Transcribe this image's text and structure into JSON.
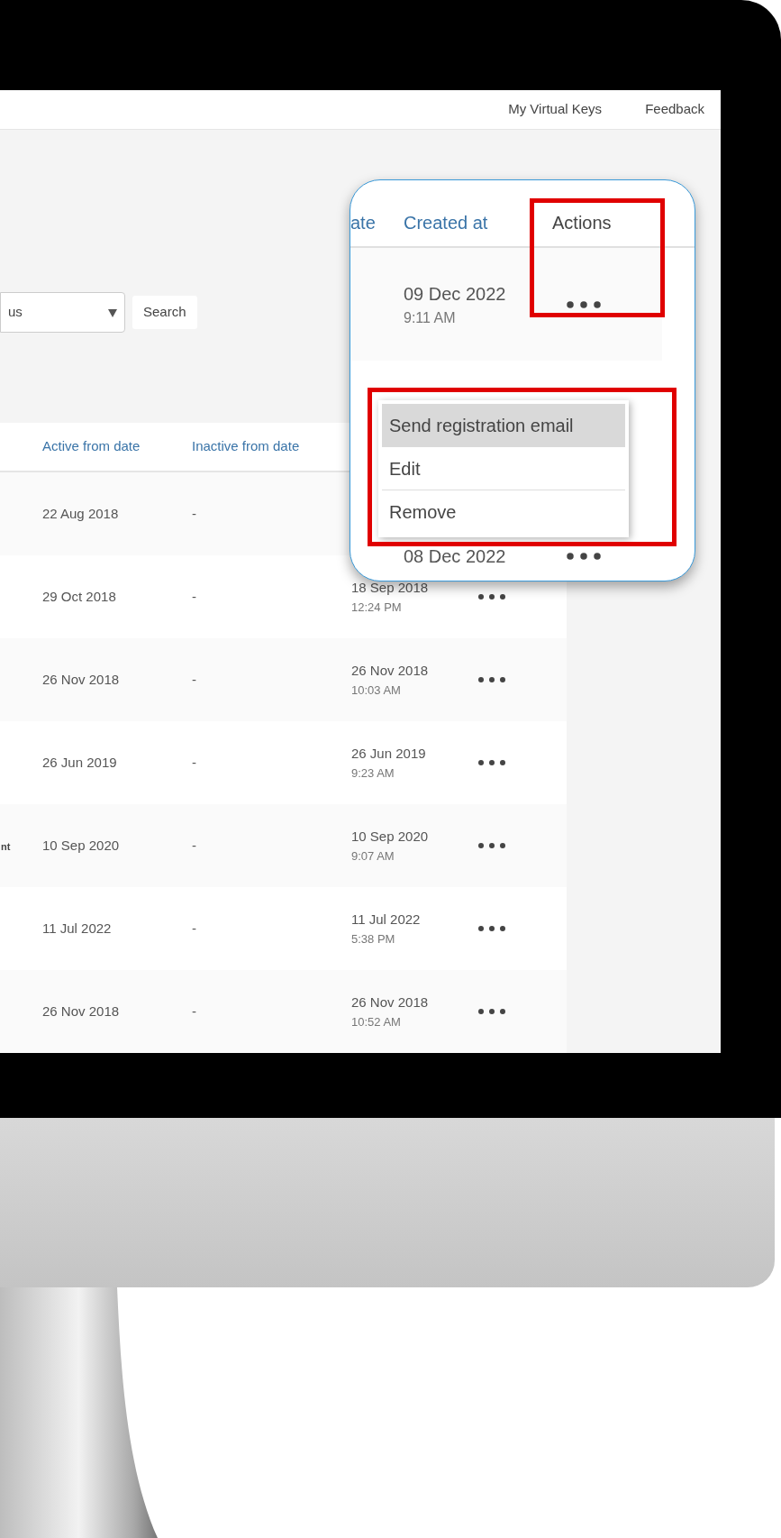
{
  "header": {
    "links": [
      "My Virtual Keys",
      "Feedback"
    ]
  },
  "filters": {
    "status_select": {
      "value": "us"
    },
    "search_button": "Search"
  },
  "table": {
    "columns": [
      "Active from date",
      "Inactive from date"
    ],
    "rows": [
      {
        "active_from": "22 Aug 2018",
        "inactive_from": "-"
      },
      {
        "active_from": "29 Oct 2018",
        "inactive_from": "-",
        "created_date": "18 Sep 2018",
        "created_time": "12:24 PM"
      },
      {
        "active_from": "26 Nov 2018",
        "inactive_from": "-",
        "created_date": "26 Nov 2018",
        "created_time": "10:03 AM"
      },
      {
        "active_from": "26 Jun 2019",
        "inactive_from": "-",
        "created_date": "26 Jun 2019",
        "created_time": "9:23 AM"
      },
      {
        "column_1": "nt",
        "active_from": "10 Sep 2020",
        "inactive_from": "-",
        "created_date": "10 Sep 2020",
        "created_time": "9:07 AM"
      },
      {
        "active_from": "11 Jul 2022",
        "inactive_from": "-",
        "created_date": "11 Jul 2022",
        "created_time": "5:38 PM"
      },
      {
        "active_from": "26 Nov 2018",
        "inactive_from": "-",
        "created_date": "26 Nov 2018",
        "created_time": "10:52 AM"
      }
    ]
  },
  "zoom_callout": {
    "columns": [
      "ate",
      "Created at",
      "Actions"
    ],
    "row": {
      "created_date": "09 Dec 2022",
      "created_time": "9:11 AM"
    },
    "menu": [
      {
        "label": "Send registration email",
        "selected": true
      },
      {
        "label": "Edit",
        "selected": false
      },
      {
        "label": "Remove",
        "selected": false
      }
    ],
    "next_row": {
      "created_date": "08 Dec 2022"
    }
  }
}
